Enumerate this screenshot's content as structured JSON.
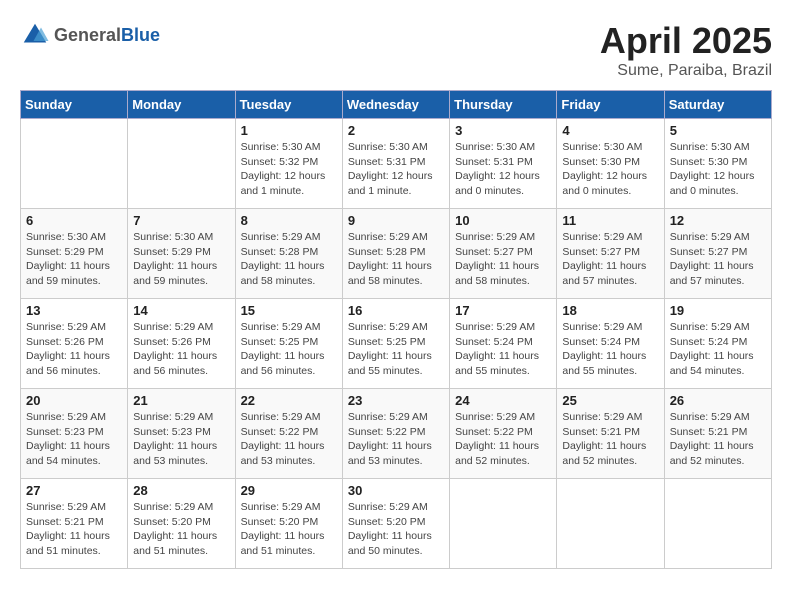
{
  "header": {
    "logo_general": "General",
    "logo_blue": "Blue",
    "title": "April 2025",
    "location": "Sume, Paraiba, Brazil"
  },
  "days_of_week": [
    "Sunday",
    "Monday",
    "Tuesday",
    "Wednesday",
    "Thursday",
    "Friday",
    "Saturday"
  ],
  "weeks": [
    [
      {
        "day": "",
        "info": ""
      },
      {
        "day": "",
        "info": ""
      },
      {
        "day": "1",
        "info": "Sunrise: 5:30 AM\nSunset: 5:32 PM\nDaylight: 12 hours and 1 minute."
      },
      {
        "day": "2",
        "info": "Sunrise: 5:30 AM\nSunset: 5:31 PM\nDaylight: 12 hours and 1 minute."
      },
      {
        "day": "3",
        "info": "Sunrise: 5:30 AM\nSunset: 5:31 PM\nDaylight: 12 hours and 0 minutes."
      },
      {
        "day": "4",
        "info": "Sunrise: 5:30 AM\nSunset: 5:30 PM\nDaylight: 12 hours and 0 minutes."
      },
      {
        "day": "5",
        "info": "Sunrise: 5:30 AM\nSunset: 5:30 PM\nDaylight: 12 hours and 0 minutes."
      }
    ],
    [
      {
        "day": "6",
        "info": "Sunrise: 5:30 AM\nSunset: 5:29 PM\nDaylight: 11 hours and 59 minutes."
      },
      {
        "day": "7",
        "info": "Sunrise: 5:30 AM\nSunset: 5:29 PM\nDaylight: 11 hours and 59 minutes."
      },
      {
        "day": "8",
        "info": "Sunrise: 5:29 AM\nSunset: 5:28 PM\nDaylight: 11 hours and 58 minutes."
      },
      {
        "day": "9",
        "info": "Sunrise: 5:29 AM\nSunset: 5:28 PM\nDaylight: 11 hours and 58 minutes."
      },
      {
        "day": "10",
        "info": "Sunrise: 5:29 AM\nSunset: 5:27 PM\nDaylight: 11 hours and 58 minutes."
      },
      {
        "day": "11",
        "info": "Sunrise: 5:29 AM\nSunset: 5:27 PM\nDaylight: 11 hours and 57 minutes."
      },
      {
        "day": "12",
        "info": "Sunrise: 5:29 AM\nSunset: 5:27 PM\nDaylight: 11 hours and 57 minutes."
      }
    ],
    [
      {
        "day": "13",
        "info": "Sunrise: 5:29 AM\nSunset: 5:26 PM\nDaylight: 11 hours and 56 minutes."
      },
      {
        "day": "14",
        "info": "Sunrise: 5:29 AM\nSunset: 5:26 PM\nDaylight: 11 hours and 56 minutes."
      },
      {
        "day": "15",
        "info": "Sunrise: 5:29 AM\nSunset: 5:25 PM\nDaylight: 11 hours and 56 minutes."
      },
      {
        "day": "16",
        "info": "Sunrise: 5:29 AM\nSunset: 5:25 PM\nDaylight: 11 hours and 55 minutes."
      },
      {
        "day": "17",
        "info": "Sunrise: 5:29 AM\nSunset: 5:24 PM\nDaylight: 11 hours and 55 minutes."
      },
      {
        "day": "18",
        "info": "Sunrise: 5:29 AM\nSunset: 5:24 PM\nDaylight: 11 hours and 55 minutes."
      },
      {
        "day": "19",
        "info": "Sunrise: 5:29 AM\nSunset: 5:24 PM\nDaylight: 11 hours and 54 minutes."
      }
    ],
    [
      {
        "day": "20",
        "info": "Sunrise: 5:29 AM\nSunset: 5:23 PM\nDaylight: 11 hours and 54 minutes."
      },
      {
        "day": "21",
        "info": "Sunrise: 5:29 AM\nSunset: 5:23 PM\nDaylight: 11 hours and 53 minutes."
      },
      {
        "day": "22",
        "info": "Sunrise: 5:29 AM\nSunset: 5:22 PM\nDaylight: 11 hours and 53 minutes."
      },
      {
        "day": "23",
        "info": "Sunrise: 5:29 AM\nSunset: 5:22 PM\nDaylight: 11 hours and 53 minutes."
      },
      {
        "day": "24",
        "info": "Sunrise: 5:29 AM\nSunset: 5:22 PM\nDaylight: 11 hours and 52 minutes."
      },
      {
        "day": "25",
        "info": "Sunrise: 5:29 AM\nSunset: 5:21 PM\nDaylight: 11 hours and 52 minutes."
      },
      {
        "day": "26",
        "info": "Sunrise: 5:29 AM\nSunset: 5:21 PM\nDaylight: 11 hours and 52 minutes."
      }
    ],
    [
      {
        "day": "27",
        "info": "Sunrise: 5:29 AM\nSunset: 5:21 PM\nDaylight: 11 hours and 51 minutes."
      },
      {
        "day": "28",
        "info": "Sunrise: 5:29 AM\nSunset: 5:20 PM\nDaylight: 11 hours and 51 minutes."
      },
      {
        "day": "29",
        "info": "Sunrise: 5:29 AM\nSunset: 5:20 PM\nDaylight: 11 hours and 51 minutes."
      },
      {
        "day": "30",
        "info": "Sunrise: 5:29 AM\nSunset: 5:20 PM\nDaylight: 11 hours and 50 minutes."
      },
      {
        "day": "",
        "info": ""
      },
      {
        "day": "",
        "info": ""
      },
      {
        "day": "",
        "info": ""
      }
    ]
  ]
}
